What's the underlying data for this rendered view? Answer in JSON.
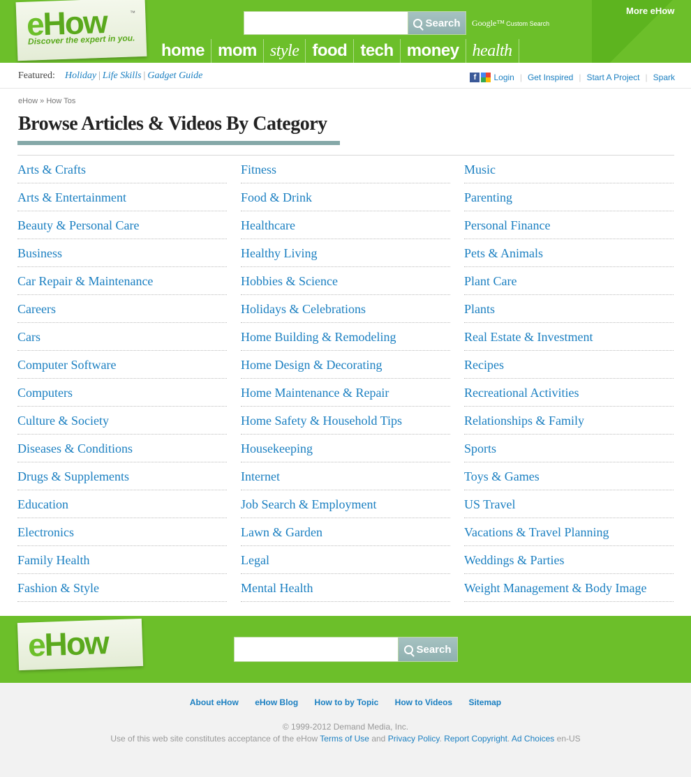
{
  "header": {
    "logo": {
      "e": "e",
      "how": "How",
      "tm": "™",
      "tagline": "Discover the expert in you."
    },
    "search": {
      "value": "",
      "button_label": "Search"
    },
    "google_label": "Google™",
    "google_custom": "Custom Search",
    "nav": [
      "home",
      "mom",
      "style",
      "food",
      "tech",
      "money",
      "health"
    ],
    "more_label": "More eHow"
  },
  "featured": {
    "label": "Featured:",
    "links": [
      "Holiday",
      "Life Skills",
      "Gadget Guide"
    ]
  },
  "utility": {
    "login": "Login",
    "links": [
      "Get Inspired",
      "Start A Project",
      "Spark"
    ]
  },
  "breadcrumb": "eHow » How Tos",
  "page_title": "Browse Articles & Videos By Category",
  "categories": {
    "col1": [
      "Arts & Crafts",
      "Arts & Entertainment",
      "Beauty & Personal Care",
      "Business",
      "Car Repair & Maintenance",
      "Careers",
      "Cars",
      "Computer Software",
      "Computers",
      "Culture & Society",
      "Diseases & Conditions",
      "Drugs & Supplements",
      "Education",
      "Electronics",
      "Family Health",
      "Fashion & Style"
    ],
    "col2": [
      "Fitness",
      "Food & Drink",
      "Healthcare",
      "Healthy Living",
      "Hobbies & Science",
      "Holidays & Celebrations",
      "Home Building & Remodeling",
      "Home Design & Decorating",
      "Home Maintenance & Repair",
      "Home Safety & Household Tips",
      "Housekeeping",
      "Internet",
      "Job Search & Employment",
      "Lawn & Garden",
      "Legal",
      "Mental Health"
    ],
    "col3": [
      "Music",
      "Parenting",
      "Personal Finance",
      "Pets & Animals",
      "Plant Care",
      "Plants",
      "Real Estate & Investment",
      "Recipes",
      "Recreational Activities",
      "Relationships & Family",
      "Sports",
      "Toys & Games",
      "US Travel",
      "Vacations & Travel Planning",
      "Weddings & Parties",
      "Weight Management & Body Image"
    ]
  },
  "footer": {
    "search": {
      "value": "",
      "button_label": "Search"
    },
    "links": [
      "About eHow",
      "eHow Blog",
      "How to by Topic",
      "How to Videos",
      "Sitemap"
    ],
    "copyright": "© 1999-2012 Demand Media, Inc.",
    "legal": {
      "prefix": "Use of this web site constitutes acceptance of the eHow",
      "terms": "Terms of Use",
      "and": "and",
      "privacy": "Privacy Policy",
      "period": ".",
      "report": "Report Copyright",
      "ad_choices": "Ad Choices",
      "locale": "en-US"
    }
  },
  "colors": {
    "brand_green": "#6cbf2a",
    "link_blue": "#1a7fc1",
    "search_button": "#9bbab9"
  }
}
